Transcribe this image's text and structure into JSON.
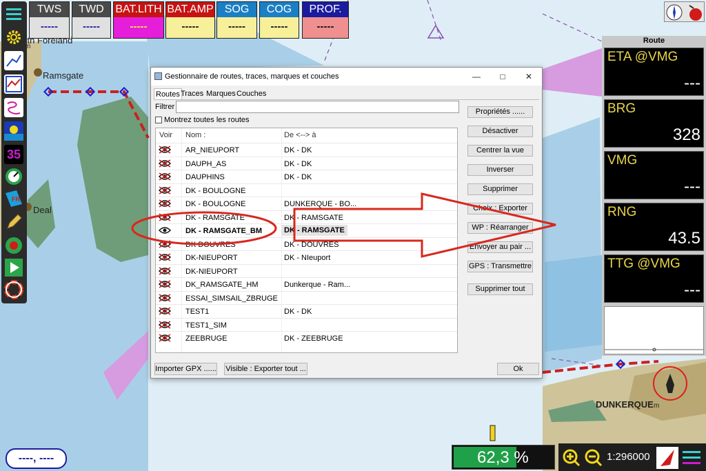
{
  "map": {
    "labels": {
      "north_foreland": "orth Foreland",
      "ramsgate": "Ramsgate",
      "deal": "Deal",
      "dunkerque": "DUNKERQUE",
      "m1": "m",
      "m2": "m"
    }
  },
  "instruments": [
    {
      "title": "TWS",
      "value": "-----",
      "bg": "#e0e0e0",
      "title_bg": "#4a4a4a",
      "value_color": "#1b1b9e"
    },
    {
      "title": "TWD",
      "value": "-----",
      "bg": "#e0e0e0",
      "title_bg": "#4a4a4a",
      "value_color": "#1b1b9e"
    },
    {
      "title": "BAT.LITH",
      "value": "-----",
      "bg": "#e51ed9",
      "title_bg": "#c61313",
      "value_color": "#f7ef4a"
    },
    {
      "title": "BAT.AMP",
      "value": "-----",
      "bg": "#f7ef9a",
      "title_bg": "#c61313",
      "value_color": "#111111"
    },
    {
      "title": "SOG",
      "value": "-----",
      "bg": "#f7ef9a",
      "title_bg": "#1a7fc4",
      "value_color": "#111111"
    },
    {
      "title": "COG",
      "value": "-----",
      "bg": "#f7ef9a",
      "title_bg": "#1a7fc4",
      "value_color": "#111111"
    },
    {
      "title": "PROF.",
      "value": "-----",
      "bg": "#f08f8f",
      "title_bg": "#1b1b9e",
      "value_color": "#111111"
    }
  ],
  "toolbar": [
    "menu-icon",
    "gear-icon",
    "route-icon",
    "chart-icon",
    "track-icon",
    "tide-icon",
    "digital-display-icon",
    "gauge-icon",
    "flag-fr-icon",
    "pencil-icon",
    "mark-icon",
    "play-icon",
    "lifebuoy-icon"
  ],
  "toolbar_digits": "35",
  "right_panel": {
    "title": "Route",
    "boxes": [
      {
        "label": "ETA  @VMG",
        "value": "---"
      },
      {
        "label": "BRG",
        "value": "328"
      },
      {
        "label": "VMG",
        "value": "---"
      },
      {
        "label": "RNG",
        "value": "43.5"
      },
      {
        "label": "TTG  @VMG",
        "value": "---"
      }
    ]
  },
  "dialog": {
    "title": "Gestionnaire de routes, traces, marques et couches",
    "tabs": [
      "Routes",
      "Traces",
      "Marques",
      "Couches"
    ],
    "filter_label": "Filtrer",
    "filter_value": "",
    "show_all_label": "Montrez toutes les routes",
    "columns": {
      "show": "Voir",
      "name": "Nom :",
      "from_to": "De <--> à"
    },
    "rows": [
      {
        "name": "AR_NIEUPORT",
        "from_to": "DK - DK",
        "visible": false
      },
      {
        "name": "DAUPH_AS",
        "from_to": "DK - DK",
        "visible": false
      },
      {
        "name": "DAUPHINS",
        "from_to": "DK - DK",
        "visible": false
      },
      {
        "name": "DK - BOULOGNE",
        "from_to": "",
        "visible": false
      },
      {
        "name": "DK - BOULOGNE",
        "from_to": "DUNKERQUE - BO...",
        "visible": false
      },
      {
        "name": "DK - RAMSGATE",
        "from_to": "DK - RAMSGATE",
        "visible": false
      },
      {
        "name": "DK - RAMSGATE_BM",
        "from_to": "DK - RAMSGATE",
        "visible": true,
        "selected": true
      },
      {
        "name": "DK DOUVRES",
        "from_to": "DK - DOUVRES",
        "visible": false
      },
      {
        "name": "DK-NIEUPORT",
        "from_to": "DK - NIeuport",
        "visible": false
      },
      {
        "name": "DK-NIEUPORT",
        "from_to": "",
        "visible": false
      },
      {
        "name": "DK_RAMSGATE_HM",
        "from_to": "Dunkerque - Ram...",
        "visible": false
      },
      {
        "name": "ESSAI_SIMSAIL_ZBRUGE",
        "from_to": "",
        "visible": false
      },
      {
        "name": "TEST1",
        "from_to": "DK - DK",
        "visible": false
      },
      {
        "name": "TEST1_SIM",
        "from_to": "",
        "visible": false
      },
      {
        "name": "ZEEBRUGE",
        "from_to": "DK - ZEEBRUGE",
        "visible": false
      }
    ],
    "side_buttons": [
      "Propriétés ......",
      "Désactiver",
      "Centrer la vue",
      "Inverser",
      "Supprimer",
      "Choix : Exporter",
      "WP : Réarranger",
      "Envoyer au pair ...",
      "GPS : Transmettre",
      "Supprimer tout"
    ],
    "bottom_buttons": {
      "import": "Importer GPX ......",
      "export": "Visible : Exporter tout ...",
      "ok": "Ok"
    }
  },
  "bottom": {
    "coords": "----, ----",
    "battery_percent_label": "62,3 %",
    "battery_fraction": 0.623,
    "scale": "1:296000"
  },
  "colors": {
    "land": "#cfc39a",
    "shallow": "#a9cfe8",
    "deep": "#dfeef6",
    "green": "#6f9d7a",
    "route": "#cc1f1f",
    "annotation": "#d8281e"
  }
}
